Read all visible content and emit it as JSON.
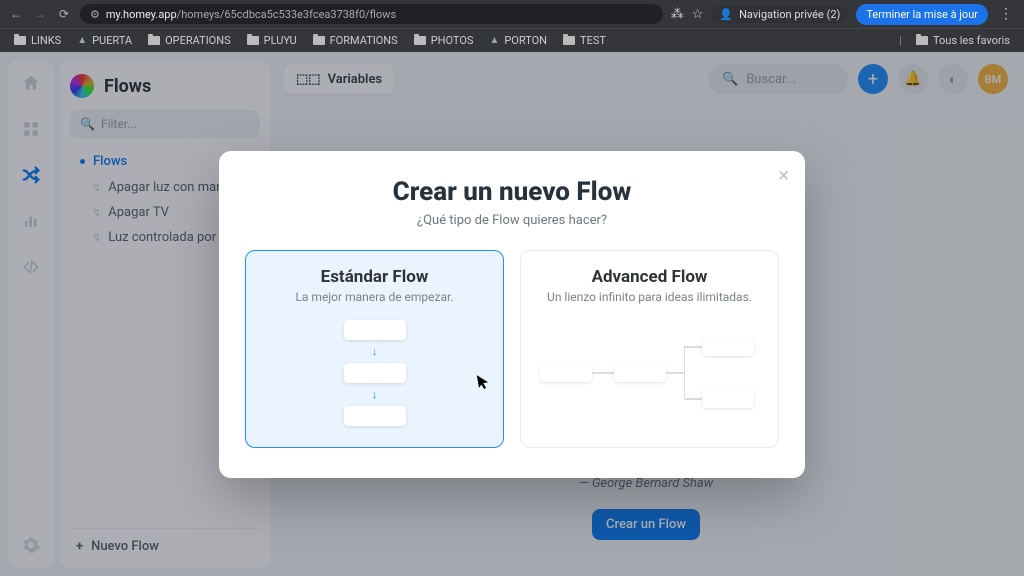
{
  "browser": {
    "url_host": "my.homey.app",
    "url_path": "/homeys/65cdbca5c533e3fcea3738f0/flows",
    "incognito_label": "Navigation privée (2)",
    "update_label": "Terminer la mise à jour"
  },
  "bookmarks": {
    "items": [
      "LINKS",
      "PUERTA",
      "OPERATIONS",
      "PLUYU",
      "FORMATIONS",
      "PHOTOS",
      "PORTON",
      "TEST"
    ],
    "all": "Tous les favoris"
  },
  "panel": {
    "title": "Flows",
    "filter_placeholder": "Filter...",
    "root_label": "Flows",
    "items": [
      "Apagar luz con mando",
      "Apagar TV",
      "Luz controlada por movimiento"
    ],
    "new_label": "Nuevo Flow"
  },
  "topbar": {
    "variables": "Variables",
    "search_placeholder": "Buscar...",
    "avatar": "BM"
  },
  "quote": {
    "author": "— George Bernard Shaw",
    "cta": "Crear un Flow"
  },
  "modal": {
    "title": "Crear un nuevo Flow",
    "subtitle": "¿Qué tipo de Flow quieres hacer?",
    "standard_title": "Estándar Flow",
    "standard_sub": "La mejor manera de empezar.",
    "advanced_title": "Advanced Flow",
    "advanced_sub": "Un lienzo infinito para ideas ilimitadas."
  }
}
